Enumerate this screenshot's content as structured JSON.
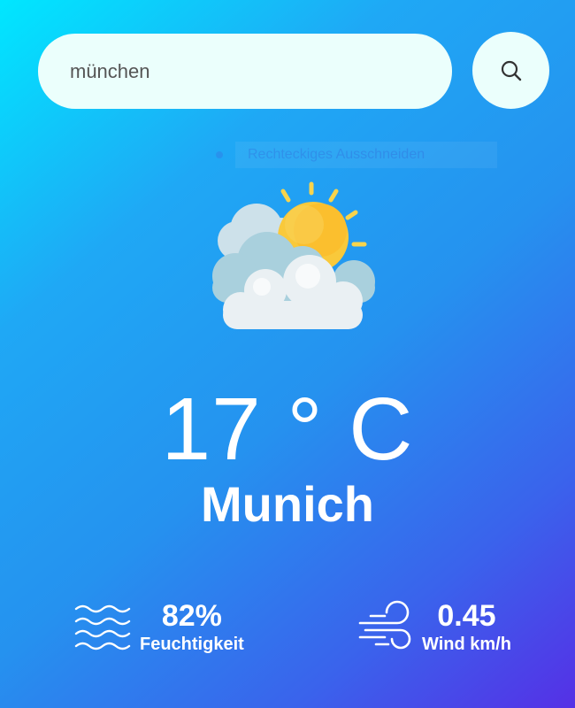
{
  "search": {
    "value": "münchen"
  },
  "overlay": {
    "tooltip_text": "Rechteckiges Ausschneiden"
  },
  "weather": {
    "icon": "partly-cloudy-icon",
    "temperature": "17 ° C",
    "city": "Munich"
  },
  "details": {
    "humidity": {
      "icon": "humidity-waves-icon",
      "value": "82%",
      "label": "Feuchtigkeit"
    },
    "wind": {
      "icon": "wind-icon",
      "value": "0.45",
      "label": "Wind km/h"
    }
  },
  "colors": {
    "gradient_start": "#00e7ff",
    "gradient_end": "#5530e6",
    "input_bg": "#ebfffc",
    "sun": "#f9c93b",
    "cloud": "#e8eef2"
  }
}
